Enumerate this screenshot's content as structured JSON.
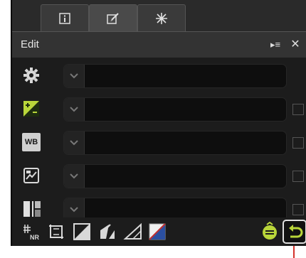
{
  "tabs": [
    {
      "icon": "info-icon",
      "active": false
    },
    {
      "icon": "edit-brush-icon",
      "active": true
    },
    {
      "icon": "magic-wand-icon",
      "active": false
    }
  ],
  "panel": {
    "title": "Edit",
    "title_icons": [
      "list-expand-icon",
      "close-icon"
    ],
    "close_glyph": "✕",
    "expand_glyph": "▸≡"
  },
  "rows": [
    {
      "name": "settings",
      "icon": "gear-icon",
      "selected_value": "",
      "has_checkbox": false
    },
    {
      "name": "exposure-compensation",
      "icon": "exposure-compensation-icon",
      "selected_value": "",
      "has_checkbox": true
    },
    {
      "name": "white-balance",
      "icon": "white-balance-icon",
      "selected_value": "",
      "has_checkbox": true
    },
    {
      "name": "picture-control",
      "icon": "picture-control-icon",
      "selected_value": "",
      "has_checkbox": true
    },
    {
      "name": "d-lighting",
      "icon": "d-lighting-icon",
      "selected_value": "",
      "has_checkbox": true
    }
  ],
  "row_icon_labels": {
    "white_balance": "WB"
  },
  "bottom_tools": [
    "noise-reduction-icon",
    "crop-icon",
    "levels-curves-icon",
    "color-booster-icon",
    "straighten-icon",
    "lch-editor-icon"
  ],
  "bottom_actions": [
    "apply-adjustments-icon",
    "undo-icon"
  ],
  "colors": {
    "panel_bg": "#1c1c1c",
    "accent_red": "#d4322b",
    "undo_border": "#e0e0e0"
  }
}
